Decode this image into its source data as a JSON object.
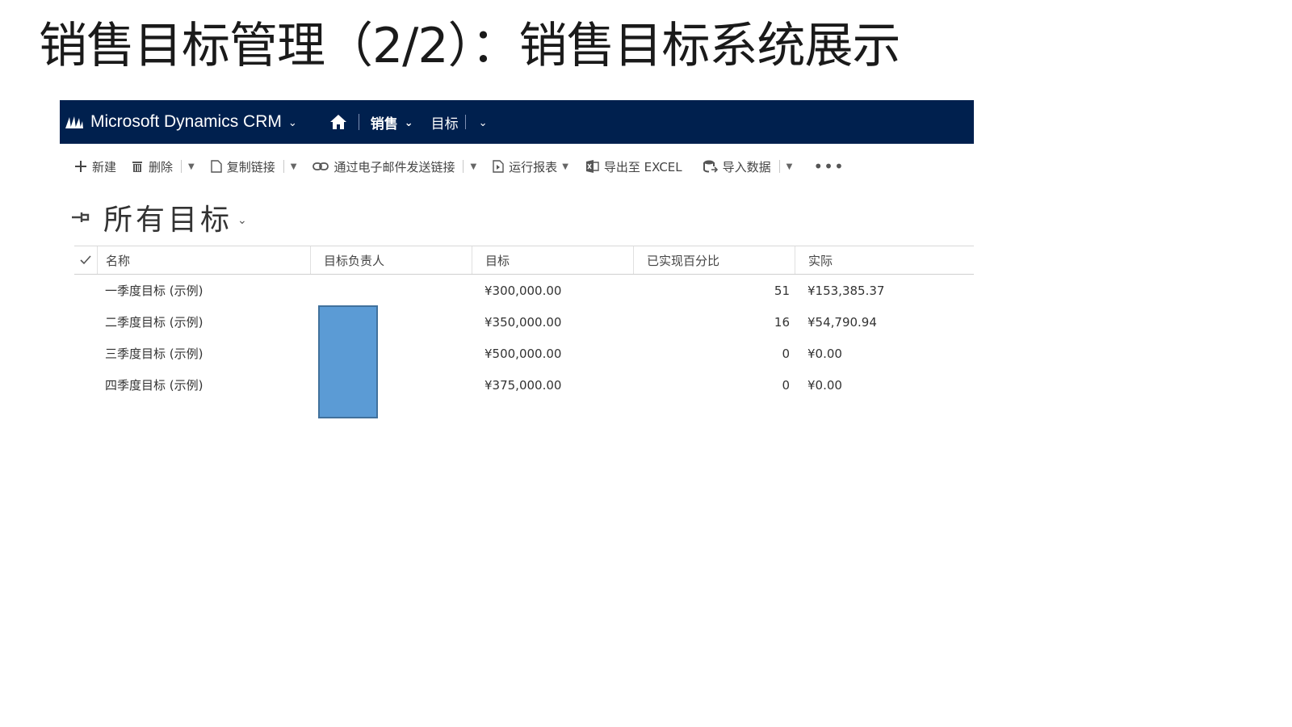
{
  "slide": {
    "title": "销售目标管理（2/2）：销售目标系统展示"
  },
  "navbar": {
    "app_name": "Microsoft Dynamics CRM",
    "area": "销售",
    "entity": "目标"
  },
  "toolbar": {
    "new": "新建",
    "delete": "删除",
    "copy_link": "复制链接",
    "email_link": "通过电子邮件发送链接",
    "run_report": "运行报表",
    "export_excel": "导出至 EXCEL",
    "import_data": "导入数据",
    "more": "•••"
  },
  "view": {
    "title": "所有目标"
  },
  "grid": {
    "columns": {
      "name": "名称",
      "owner": "目标负责人",
      "target": "目标",
      "percent": "已实现百分比",
      "actual": "实际"
    },
    "rows": [
      {
        "name": "一季度目标 (示例)",
        "target": "¥300,000.00",
        "percent": "51",
        "actual": "¥153,385.37"
      },
      {
        "name": "二季度目标 (示例)",
        "target": "¥350,000.00",
        "percent": "16",
        "actual": "¥54,790.94"
      },
      {
        "name": "三季度目标 (示例)",
        "target": "¥500,000.00",
        "percent": "0",
        "actual": "¥0.00"
      },
      {
        "name": "四季度目标 (示例)",
        "target": "¥375,000.00",
        "percent": "0",
        "actual": "¥0.00"
      }
    ]
  },
  "colors": {
    "navbar_bg": "#00204e",
    "redaction": "#5b9bd5"
  }
}
